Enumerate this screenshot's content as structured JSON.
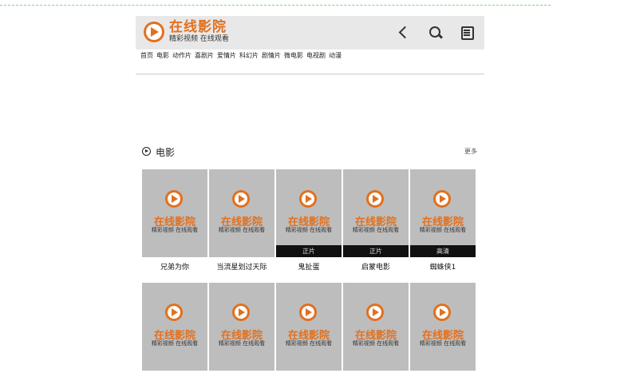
{
  "logo": {
    "title": "在线影院",
    "subtitle": "精彩视频 在线观看"
  },
  "nav": [
    "首页",
    "电影",
    "动作片",
    "喜剧片",
    "爱情片",
    "科幻片",
    "剧情片",
    "微电影",
    "电视剧",
    "动漫"
  ],
  "section": {
    "title": "电影",
    "more": "更多"
  },
  "thumb_placeholder": {
    "title": "在线影院",
    "subtitle": "精彩视频 在线观看"
  },
  "movies_row1": [
    {
      "title": "兄弟为你",
      "badge": ""
    },
    {
      "title": "当流星划过天际",
      "badge": ""
    },
    {
      "title": "鬼扯蛋",
      "badge": "正片"
    },
    {
      "title": "启蒙电影",
      "badge": "正片"
    },
    {
      "title": "蜘蛛侠1",
      "badge": "高清"
    }
  ],
  "colors": {
    "brand": "#e2701e",
    "header_bg": "#e8e8e8",
    "thumb_bg": "#bdbdbd"
  }
}
